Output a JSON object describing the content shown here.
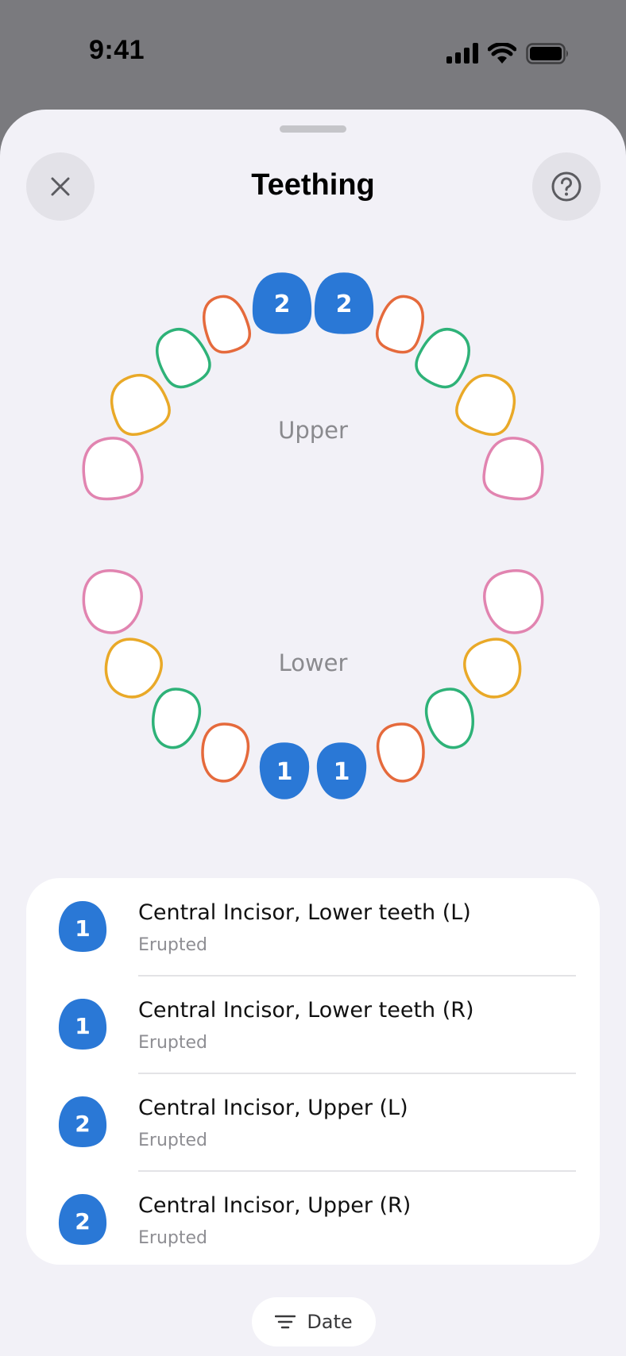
{
  "status_bar": {
    "time": "9:41",
    "icons": [
      "cellular-signal-icon",
      "wifi-icon",
      "battery-icon"
    ]
  },
  "header": {
    "title": "Teething",
    "close_icon": "close-icon",
    "help_icon": "help-icon"
  },
  "diagram": {
    "upper_label": "Upper",
    "lower_label": "Lower",
    "upper_teeth": [
      {
        "id": "upper-right-second-molar",
        "color": "#e184b0",
        "number": ""
      },
      {
        "id": "upper-right-first-molar",
        "color": "#e9a928",
        "number": ""
      },
      {
        "id": "upper-right-canine",
        "color": "#2eb278",
        "number": ""
      },
      {
        "id": "upper-right-lateral-incisor",
        "color": "#e56a3c",
        "number": ""
      },
      {
        "id": "upper-right-central-incisor",
        "color": "#2a78d6",
        "number": "2",
        "filled": true
      },
      {
        "id": "upper-left-central-incisor",
        "color": "#2a78d6",
        "number": "2",
        "filled": true
      },
      {
        "id": "upper-left-lateral-incisor",
        "color": "#e56a3c",
        "number": ""
      },
      {
        "id": "upper-left-canine",
        "color": "#2eb278",
        "number": ""
      },
      {
        "id": "upper-left-first-molar",
        "color": "#e9a928",
        "number": ""
      },
      {
        "id": "upper-left-second-molar",
        "color": "#e184b0",
        "number": ""
      }
    ],
    "lower_teeth": [
      {
        "id": "lower-right-second-molar",
        "color": "#e184b0",
        "number": ""
      },
      {
        "id": "lower-right-first-molar",
        "color": "#e9a928",
        "number": ""
      },
      {
        "id": "lower-right-canine",
        "color": "#2eb278",
        "number": ""
      },
      {
        "id": "lower-right-lateral-incisor",
        "color": "#e56a3c",
        "number": ""
      },
      {
        "id": "lower-right-central-incisor",
        "color": "#2a78d6",
        "number": "1",
        "filled": true
      },
      {
        "id": "lower-left-central-incisor",
        "color": "#2a78d6",
        "number": "1",
        "filled": true
      },
      {
        "id": "lower-left-lateral-incisor",
        "color": "#e56a3c",
        "number": ""
      },
      {
        "id": "lower-left-canine",
        "color": "#2eb278",
        "number": ""
      },
      {
        "id": "lower-left-first-molar",
        "color": "#e9a928",
        "number": ""
      },
      {
        "id": "lower-left-second-molar",
        "color": "#e184b0",
        "number": ""
      }
    ]
  },
  "teeth_list": {
    "items": [
      {
        "number": "1",
        "title": "Central Incisor, Lower teeth (L)",
        "status": "Erupted"
      },
      {
        "number": "1",
        "title": "Central Incisor, Lower teeth (R)",
        "status": "Erupted"
      },
      {
        "number": "2",
        "title": "Central Incisor, Upper (L)",
        "status": "Erupted"
      },
      {
        "number": "2",
        "title": "Central Incisor, Upper (R)",
        "status": "Erupted"
      }
    ]
  },
  "sort": {
    "label": "Date",
    "icon": "sort-icon"
  },
  "colors": {
    "accent": "#2a78d6",
    "sheet_background": "#f2f1f7"
  }
}
